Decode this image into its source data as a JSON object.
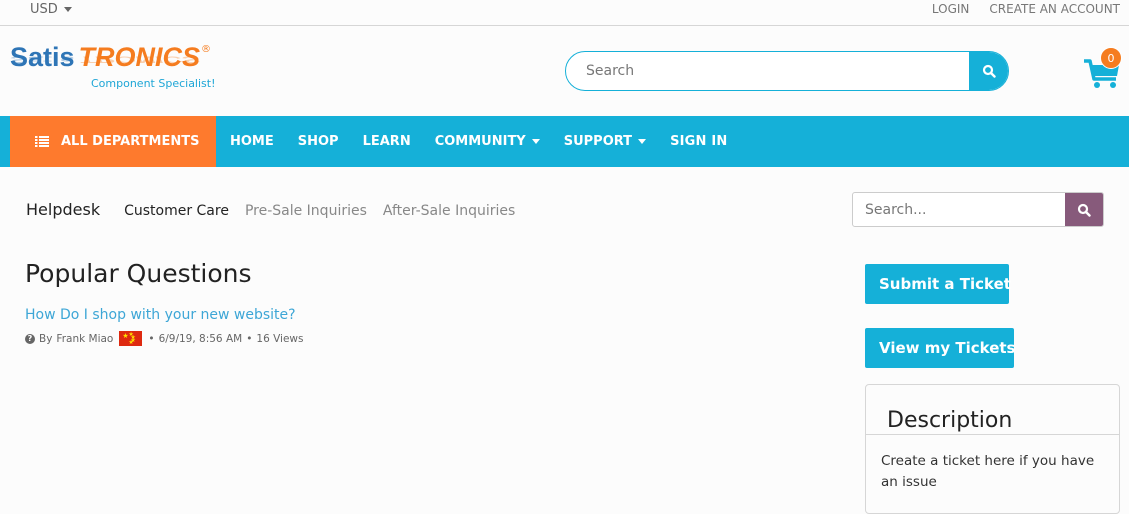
{
  "topbar": {
    "currency": "USD",
    "login": "LOGIN",
    "create_account": "CREATE AN ACCOUNT"
  },
  "brand": {
    "name_part1": "Satis",
    "name_part2": "TRONICS",
    "registered": "®",
    "tagline": "Component Specialist!",
    "colors": {
      "blue": "#2e75b6",
      "orange": "#f57c1f"
    }
  },
  "header": {
    "search_placeholder": "Search",
    "search_icon": "search-icon",
    "cart_icon": "shopping-cart-icon",
    "cart_count": "0"
  },
  "nav": {
    "all_departments": "ALL DEPARTMENTS",
    "items": [
      {
        "label": "HOME",
        "dropdown": false
      },
      {
        "label": "SHOP",
        "dropdown": false
      },
      {
        "label": "LEARN",
        "dropdown": false
      },
      {
        "label": "COMMUNITY",
        "dropdown": true
      },
      {
        "label": "SUPPORT",
        "dropdown": true
      },
      {
        "label": "SIGN IN",
        "dropdown": false
      }
    ],
    "colors": {
      "bar": "#15b0d8",
      "departments": "#fe7a2d"
    }
  },
  "helpdesk": {
    "title": "Helpdesk",
    "tabs": [
      {
        "label": "Customer Care",
        "active": true
      },
      {
        "label": "Pre-Sale Inquiries",
        "active": false
      },
      {
        "label": "After-Sale Inquiries",
        "active": false
      }
    ],
    "search_placeholder": "Search...",
    "search_button_color": "#875a7b"
  },
  "content": {
    "section_title": "Popular Questions",
    "questions": [
      {
        "title": "How Do I shop with your new website?",
        "author_prefix": "By",
        "author": "Frank Miao",
        "flag": "china-flag",
        "date": "6/9/19, 8:56 AM",
        "views": "16 Views"
      }
    ]
  },
  "sidebar": {
    "submit_ticket": "Submit a Ticket",
    "view_tickets": "View my Tickets",
    "description_title": "Description",
    "description_text": "Create a ticket here if you have an issue"
  }
}
